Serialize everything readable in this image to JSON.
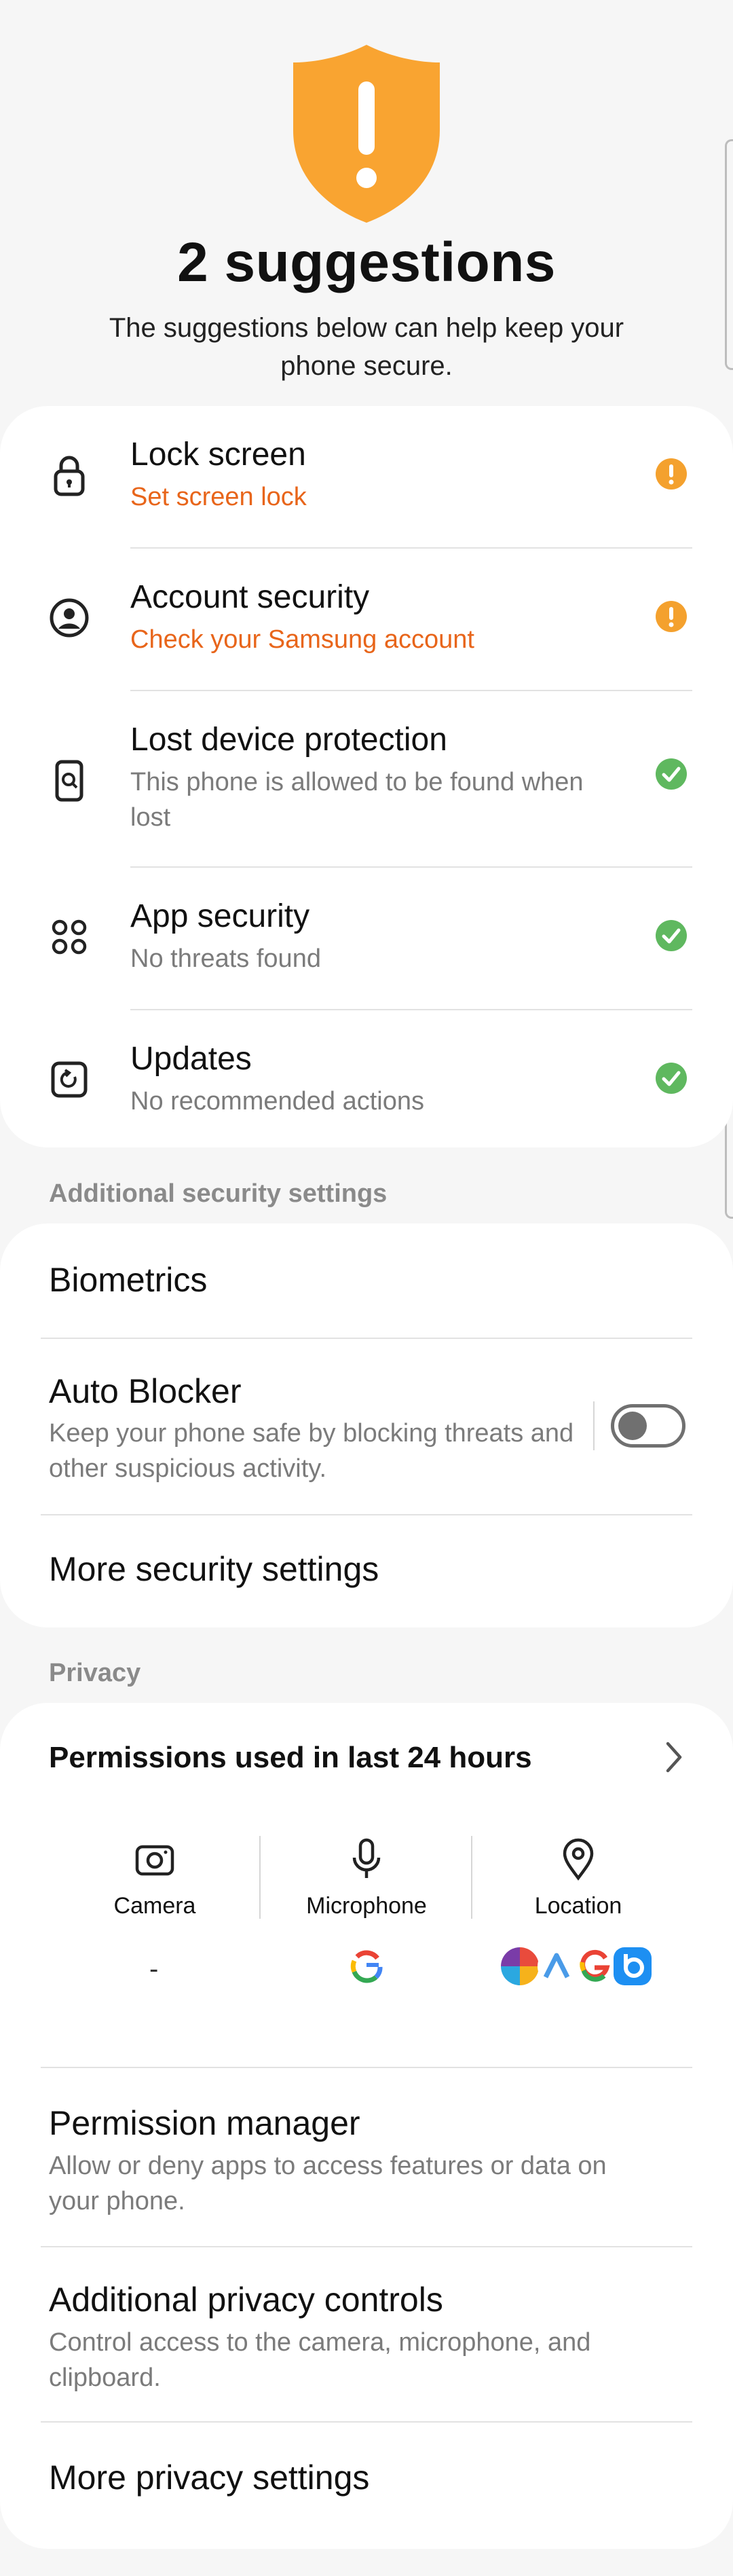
{
  "header": {
    "title": "2 suggestions",
    "subtitle": "The suggestions below can help keep your phone secure."
  },
  "security_items": [
    {
      "title": "Lock screen",
      "subtitle": "Set screen lock",
      "status": "warning",
      "icon": "lock-icon"
    },
    {
      "title": "Account security",
      "subtitle": "Check your Samsung account",
      "status": "warning",
      "icon": "account-icon"
    },
    {
      "title": "Lost device protection",
      "subtitle": "This phone is allowed to be found when lost",
      "status": "ok",
      "icon": "find-device-icon"
    },
    {
      "title": "App security",
      "subtitle": "No threats found",
      "status": "ok",
      "icon": "apps-icon"
    },
    {
      "title": "Updates",
      "subtitle": "No recommended actions",
      "status": "ok",
      "icon": "update-icon"
    }
  ],
  "additional": {
    "section_label": "Additional security settings",
    "biometrics": "Biometrics",
    "auto_blocker_title": "Auto Blocker",
    "auto_blocker_sub": "Keep your phone safe by blocking threats and other suspicious activity.",
    "auto_blocker_on": false,
    "more_security": "More security settings"
  },
  "privacy": {
    "section_label": "Privacy",
    "permissions_title": "Permissions used in last 24 hours",
    "columns": [
      {
        "label": "Camera",
        "icon": "camera-icon",
        "apps": "-"
      },
      {
        "label": "Microphone",
        "icon": "microphone-icon",
        "apps": "google-app-icon"
      },
      {
        "label": "Location",
        "icon": "location-icon",
        "apps": "four-app-icons"
      }
    ],
    "permission_manager_title": "Permission manager",
    "permission_manager_sub": "Allow or deny apps to access features or data on your phone.",
    "additional_controls_title": "Additional privacy controls",
    "additional_controls_sub": "Control access to the camera, microphone, and clipboard.",
    "more_privacy": "More privacy settings"
  },
  "colors": {
    "warning": "#f4a12e",
    "warning_text": "#e8651a",
    "ok": "#5fb85f",
    "shield": "#f9a431"
  }
}
